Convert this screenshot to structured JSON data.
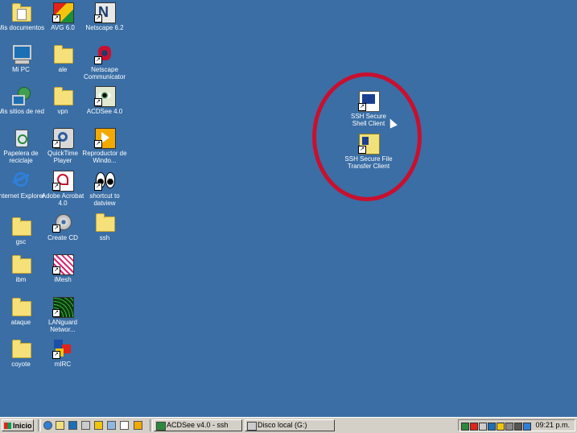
{
  "desktop": {
    "icons": [
      {
        "label": "Mis documentos"
      },
      {
        "label": "Mi PC"
      },
      {
        "label": "Mis sitios de red"
      },
      {
        "label": "Papelera de reciclaje"
      },
      {
        "label": "Internet Explorer"
      },
      {
        "label": "gsc"
      },
      {
        "label": "ibm"
      },
      {
        "label": "ataque"
      },
      {
        "label": "coyote"
      },
      {
        "label": "AVG 6.0"
      },
      {
        "label": "ale"
      },
      {
        "label": "vpn"
      },
      {
        "label": "QuickTime Player"
      },
      {
        "label": "Adobe Acrobat 4.0"
      },
      {
        "label": "Create CD"
      },
      {
        "label": "iMesh"
      },
      {
        "label": "LANguard Networ..."
      },
      {
        "label": "mIRC"
      },
      {
        "label": "Netscape 6.2"
      },
      {
        "label": "Netscape Communicator"
      },
      {
        "label": "ACDSee 4.0"
      },
      {
        "label": "Reproductor de Windo..."
      },
      {
        "label": "shortcut to datview"
      },
      {
        "label": "ssh"
      },
      {
        "label": "SSH Secure Shell Client"
      },
      {
        "label": "SSH Secure File Transfer Client"
      }
    ]
  },
  "taskbar": {
    "start_label": "Inicio",
    "tasks": [
      {
        "label": "ACDSee v4.0 - ssh"
      },
      {
        "label": "Disco local (G:)"
      }
    ],
    "clock": "09:21 p.m."
  },
  "colors": {
    "desktop": "#3a6ea5",
    "highlight_ring": "#c8102e",
    "taskbar": "#d4d0c8"
  }
}
